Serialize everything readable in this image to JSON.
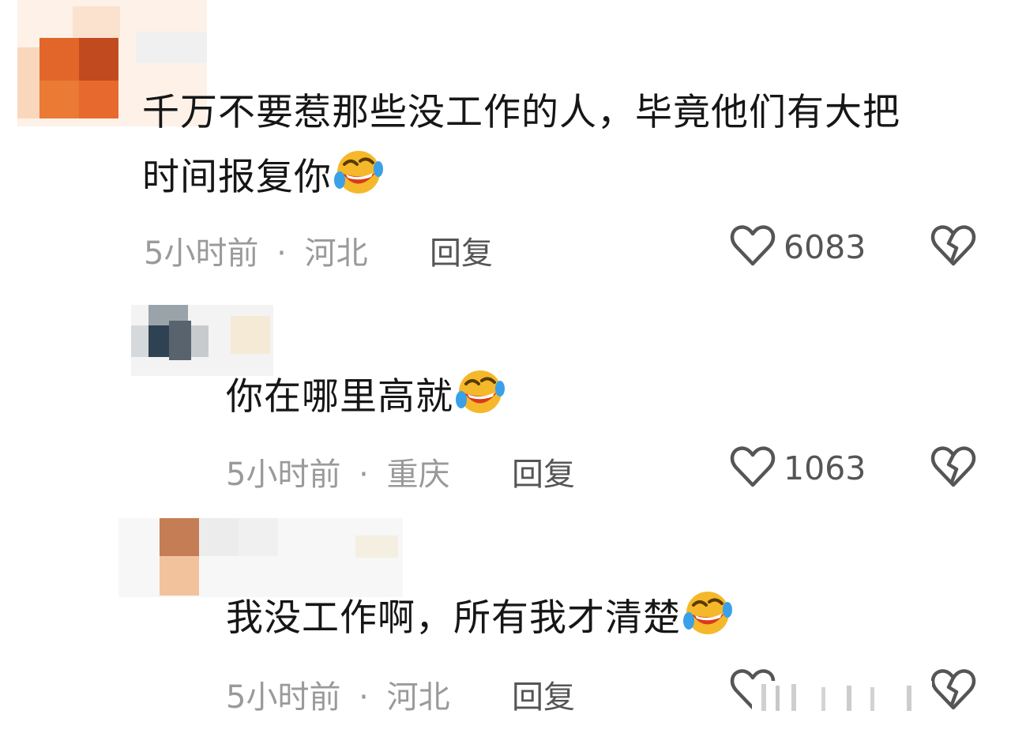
{
  "comments": [
    {
      "text_line1": "千万不要惹那些没工作的人，毕竟他们有大把",
      "text_line2": "时间报复你",
      "emoji": "rofl-emoji",
      "time": "5小时前",
      "dot": "·",
      "location": "河北",
      "reply_label": "回复",
      "likes": "6083"
    },
    {
      "text_line1": "你在哪里高就",
      "emoji": "rofl-emoji",
      "time": "5小时前",
      "dot": "·",
      "location": "重庆",
      "reply_label": "回复",
      "likes": "1063"
    },
    {
      "text_line1": "我没工作啊，所有我才清楚",
      "emoji": "rofl-emoji",
      "time": "5小时前",
      "dot": "·",
      "location": "河北",
      "reply_label": "回复"
    }
  ],
  "icons": {
    "like": "heart-outline-icon",
    "dislike": "broken-heart-icon"
  },
  "colors": {
    "text": "#161616",
    "meta": "#9a9a9a",
    "action": "#555555",
    "emoji_face": "#f5b82a"
  }
}
